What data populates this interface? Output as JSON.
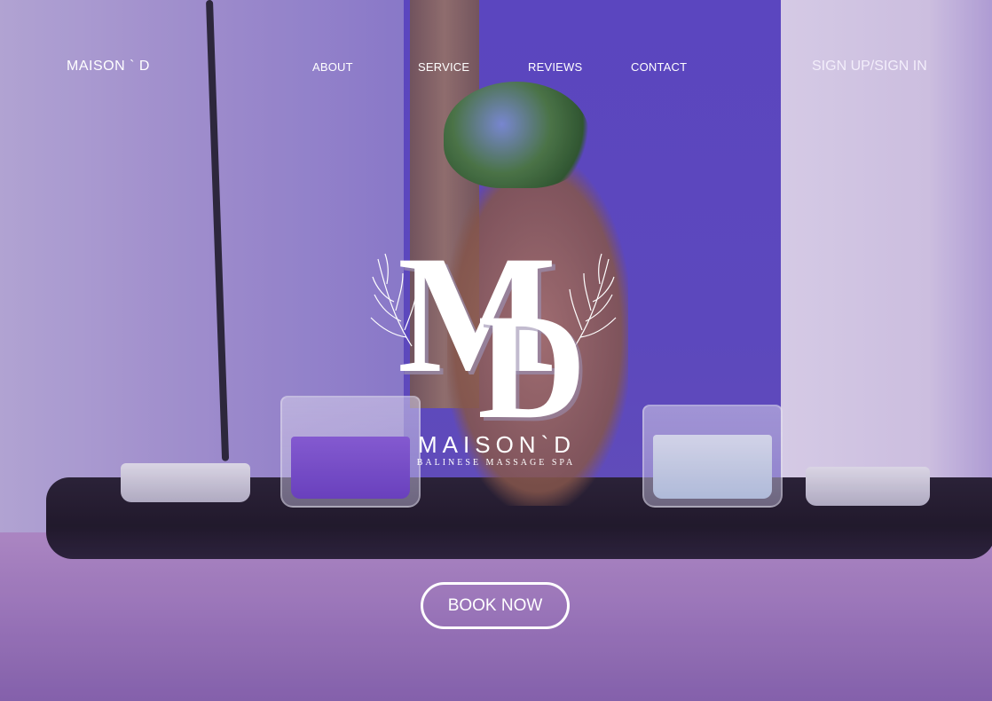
{
  "brand": {
    "name": "MAISON ` D"
  },
  "nav": {
    "items": [
      {
        "label": "ABOUT"
      },
      {
        "label": "SERVICE"
      },
      {
        "label": "REVIEWS"
      },
      {
        "label": "CONTACT"
      }
    ],
    "auth_label": "SIGN UP/SIGN IN"
  },
  "logo": {
    "monogram": "MD",
    "name": "MAISON`D",
    "tagline": "BALINESE MASSAGE SPA"
  },
  "cta": {
    "label": "BOOK NOW"
  },
  "colors": {
    "text": "#ffffff",
    "accent": "#5f4bc4"
  },
  "hero_image": "spa-candles-vase-photo"
}
